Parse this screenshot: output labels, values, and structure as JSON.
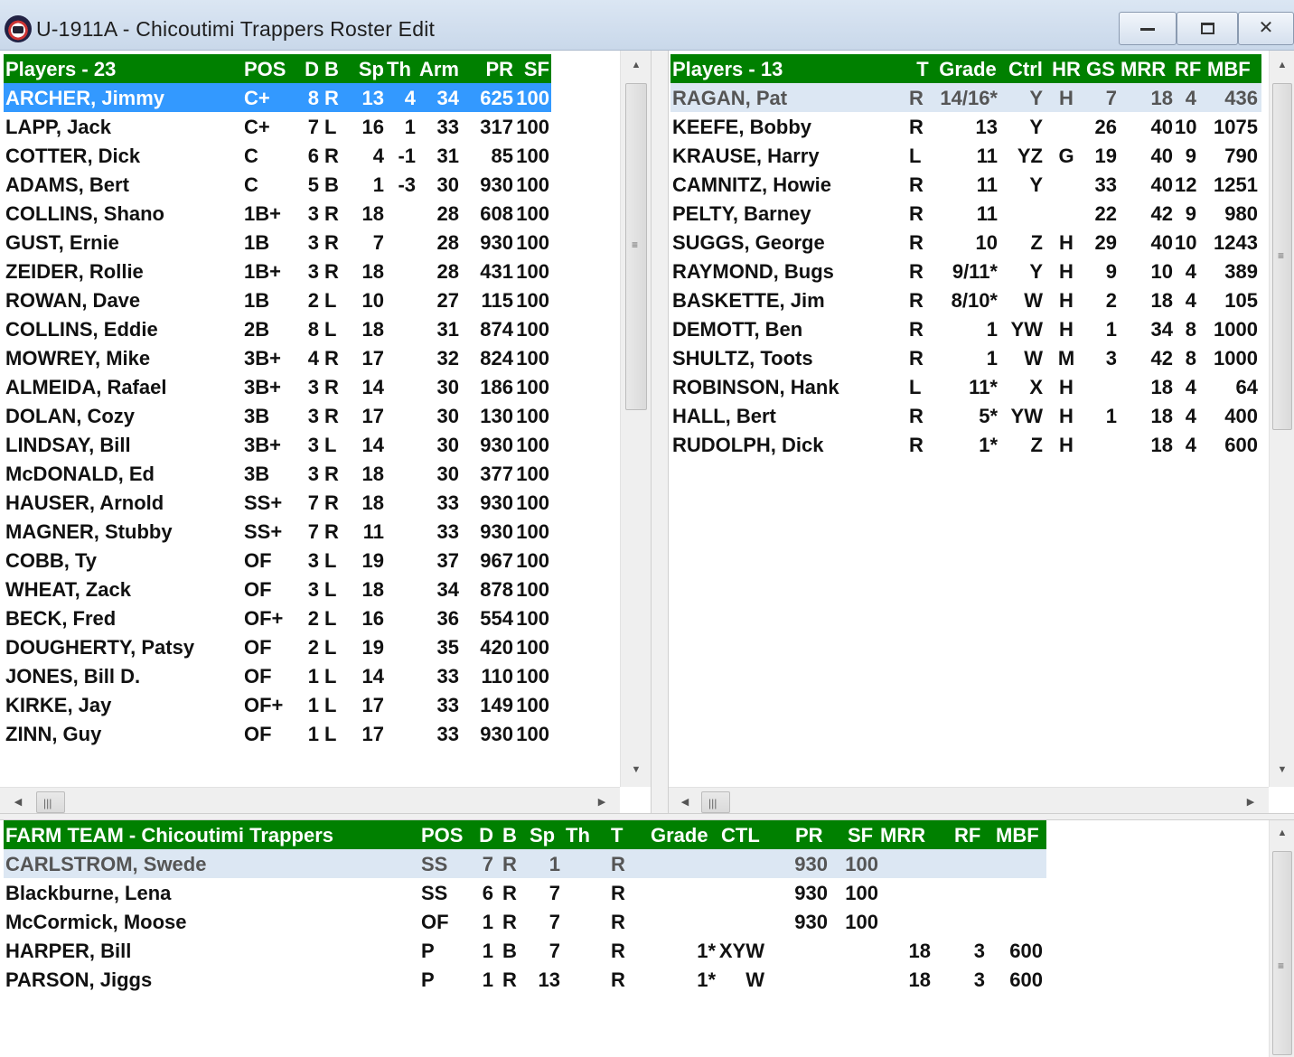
{
  "window": {
    "title": "U-1911A - Chicoutimi Trappers Roster Edit",
    "minimize_label": "",
    "maximize_label": "",
    "close_label": "✕"
  },
  "colors": {
    "header_green": "#008000",
    "selected_blue": "#3399ff",
    "highlight_row": "#dce7f3"
  },
  "batters": {
    "headers": [
      "Players - 23",
      "POS",
      "D",
      "B",
      "Sp",
      "Th",
      "Arm",
      "PR",
      "SF"
    ],
    "rows": [
      [
        "ARCHER, Jimmy",
        "C+",
        "8",
        "R",
        "13",
        "4",
        "34",
        "625",
        "100"
      ],
      [
        "LAPP, Jack",
        "C+",
        "7",
        "L",
        "16",
        "1",
        "33",
        "317",
        "100"
      ],
      [
        "COTTER, Dick",
        "C",
        "6",
        "R",
        "4",
        "-1",
        "31",
        "85",
        "100"
      ],
      [
        "ADAMS, Bert",
        "C",
        "5",
        "B",
        "1",
        "-3",
        "30",
        "930",
        "100"
      ],
      [
        "COLLINS, Shano",
        "1B+",
        "3",
        "R",
        "18",
        "",
        "28",
        "608",
        "100"
      ],
      [
        "GUST, Ernie",
        "1B",
        "3",
        "R",
        "7",
        "",
        "28",
        "930",
        "100"
      ],
      [
        "ZEIDER, Rollie",
        "1B+",
        "3",
        "R",
        "18",
        "",
        "28",
        "431",
        "100"
      ],
      [
        "ROWAN, Dave",
        "1B",
        "2",
        "L",
        "10",
        "",
        "27",
        "115",
        "100"
      ],
      [
        "COLLINS, Eddie",
        "2B",
        "8",
        "L",
        "18",
        "",
        "31",
        "874",
        "100"
      ],
      [
        "MOWREY, Mike",
        "3B+",
        "4",
        "R",
        "17",
        "",
        "32",
        "824",
        "100"
      ],
      [
        "ALMEIDA, Rafael",
        "3B+",
        "3",
        "R",
        "14",
        "",
        "30",
        "186",
        "100"
      ],
      [
        "DOLAN, Cozy",
        "3B",
        "3",
        "R",
        "17",
        "",
        "30",
        "130",
        "100"
      ],
      [
        "LINDSAY, Bill",
        "3B+",
        "3",
        "L",
        "14",
        "",
        "30",
        "930",
        "100"
      ],
      [
        "McDONALD, Ed",
        "3B",
        "3",
        "R",
        "18",
        "",
        "30",
        "377",
        "100"
      ],
      [
        "HAUSER, Arnold",
        "SS+",
        "7",
        "R",
        "18",
        "",
        "33",
        "930",
        "100"
      ],
      [
        "MAGNER, Stubby",
        "SS+",
        "7",
        "R",
        "11",
        "",
        "33",
        "930",
        "100"
      ],
      [
        "COBB, Ty",
        "OF",
        "3",
        "L",
        "19",
        "",
        "37",
        "967",
        "100"
      ],
      [
        "WHEAT, Zack",
        "OF",
        "3",
        "L",
        "18",
        "",
        "34",
        "878",
        "100"
      ],
      [
        "BECK, Fred",
        "OF+",
        "2",
        "L",
        "16",
        "",
        "36",
        "554",
        "100"
      ],
      [
        "DOUGHERTY, Patsy",
        "OF",
        "2",
        "L",
        "19",
        "",
        "35",
        "420",
        "100"
      ],
      [
        "JONES, Bill D.",
        "OF",
        "1",
        "L",
        "14",
        "",
        "33",
        "110",
        "100"
      ],
      [
        "KIRKE, Jay",
        "OF+",
        "1",
        "L",
        "17",
        "",
        "33",
        "149",
        "100"
      ],
      [
        "ZINN, Guy",
        "OF",
        "1",
        "L",
        "17",
        "",
        "33",
        "930",
        "100"
      ]
    ]
  },
  "pitchers": {
    "headers": [
      "Players - 13",
      "T",
      "Grade",
      "Ctrl",
      "HR",
      "GS",
      "MRR",
      "RF",
      "MBF"
    ],
    "rows": [
      [
        "RAGAN, Pat",
        "R",
        "14/16*",
        "Y",
        "H",
        "7",
        "18",
        "4",
        "436"
      ],
      [
        "KEEFE, Bobby",
        "R",
        "13",
        "Y",
        "",
        "26",
        "40",
        "10",
        "1075"
      ],
      [
        "KRAUSE, Harry",
        "L",
        "11",
        "YZ",
        "G",
        "19",
        "40",
        "9",
        "790"
      ],
      [
        "CAMNITZ, Howie",
        "R",
        "11",
        "Y",
        "",
        "33",
        "40",
        "12",
        "1251"
      ],
      [
        "PELTY, Barney",
        "R",
        "11",
        "",
        "",
        "22",
        "42",
        "9",
        "980"
      ],
      [
        "SUGGS, George",
        "R",
        "10",
        "Z",
        "H",
        "29",
        "40",
        "10",
        "1243"
      ],
      [
        "RAYMOND, Bugs",
        "R",
        "9/11*",
        "Y",
        "H",
        "9",
        "10",
        "4",
        "389"
      ],
      [
        "BASKETTE, Jim",
        "R",
        "8/10*",
        "W",
        "H",
        "2",
        "18",
        "4",
        "105"
      ],
      [
        "DEMOTT, Ben",
        "R",
        "1",
        "YW",
        "H",
        "1",
        "34",
        "8",
        "1000"
      ],
      [
        "SHULTZ, Toots",
        "R",
        "1",
        "W",
        "M",
        "3",
        "42",
        "8",
        "1000"
      ],
      [
        "ROBINSON, Hank",
        "L",
        "11*",
        "X",
        "H",
        "",
        "18",
        "4",
        "64"
      ],
      [
        "HALL, Bert",
        "R",
        "5*",
        "YW",
        "H",
        "1",
        "18",
        "4",
        "400"
      ],
      [
        "RUDOLPH, Dick",
        "R",
        "1*",
        "Z",
        "H",
        "",
        "18",
        "4",
        "600"
      ]
    ]
  },
  "farm": {
    "headers": [
      "FARM TEAM - Chicoutimi Trappers",
      "POS",
      "D",
      "B",
      "Sp",
      "Th",
      "T",
      "Grade",
      "CTL",
      "PR",
      "SF",
      "MRR",
      "RF",
      "MBF"
    ],
    "rows": [
      [
        "CARLSTROM, Swede",
        "SS",
        "7",
        "R",
        "1",
        "",
        "R",
        "",
        "",
        "930",
        "100",
        "",
        "",
        ""
      ],
      [
        "Blackburne, Lena",
        "SS",
        "6",
        "R",
        "7",
        "",
        "R",
        "",
        "",
        "930",
        "100",
        "",
        "",
        ""
      ],
      [
        "McCormick, Moose",
        "OF",
        "1",
        "R",
        "7",
        "",
        "R",
        "",
        "",
        "930",
        "100",
        "",
        "",
        ""
      ],
      [
        "HARPER, Bill",
        "P",
        "1",
        "B",
        "7",
        "",
        "R",
        "1*",
        "XYW",
        "",
        "",
        "18",
        "3",
        "600"
      ],
      [
        "PARSON, Jiggs",
        "P",
        "1",
        "R",
        "13",
        "",
        "R",
        "1*",
        "W",
        "",
        "",
        "18",
        "3",
        "600"
      ]
    ]
  },
  "scroll": {
    "up": "▲",
    "down": "▼",
    "left": "◀",
    "right": "▶",
    "grip_v": "≡",
    "grip_h": "|||"
  }
}
